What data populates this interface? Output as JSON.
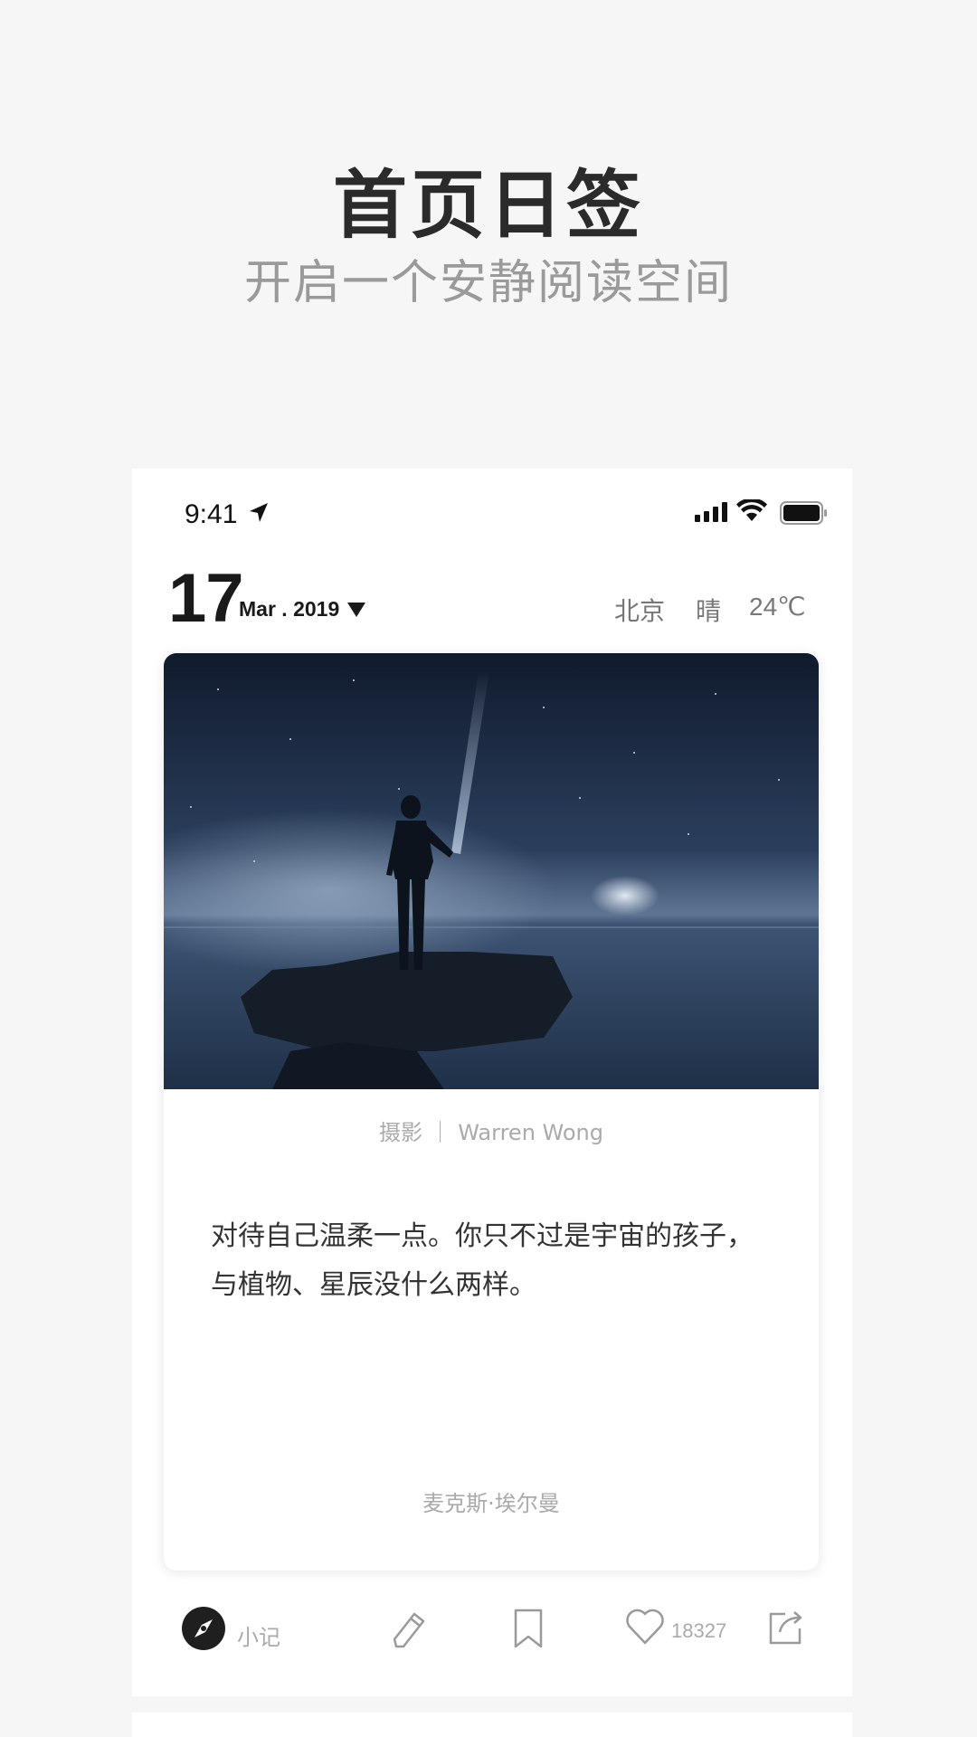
{
  "promo": {
    "title": "首页日签",
    "subtitle": "开启一个安静阅读空间"
  },
  "status_bar": {
    "time": "9:41",
    "icons": [
      "location-arrow-icon",
      "signal-icon",
      "wifi-icon",
      "battery-icon"
    ]
  },
  "header": {
    "day": "17",
    "month_year": "Mar . 2019",
    "city": "北京",
    "condition": "晴",
    "temperature": "24℃"
  },
  "card": {
    "photo_description_icon": "night-sea-photo",
    "photo_credit": "摄影 ｜ Warren Wong",
    "quote": "对待自己温柔一点。你只不过是宇宙的孩子，与植物、星辰没什么两样。",
    "author": "麦克斯·埃尔曼"
  },
  "toolbar": {
    "note_label": "小记",
    "like_count": "18327",
    "icons": [
      "compass-icon",
      "pencil-icon",
      "bookmark-icon",
      "heart-icon",
      "share-icon"
    ]
  },
  "colors": {
    "background": "#f6f6f6",
    "text_dark": "#1a1a1a",
    "text_muted": "#aaaaaa",
    "photo_dark": "#13203a"
  }
}
